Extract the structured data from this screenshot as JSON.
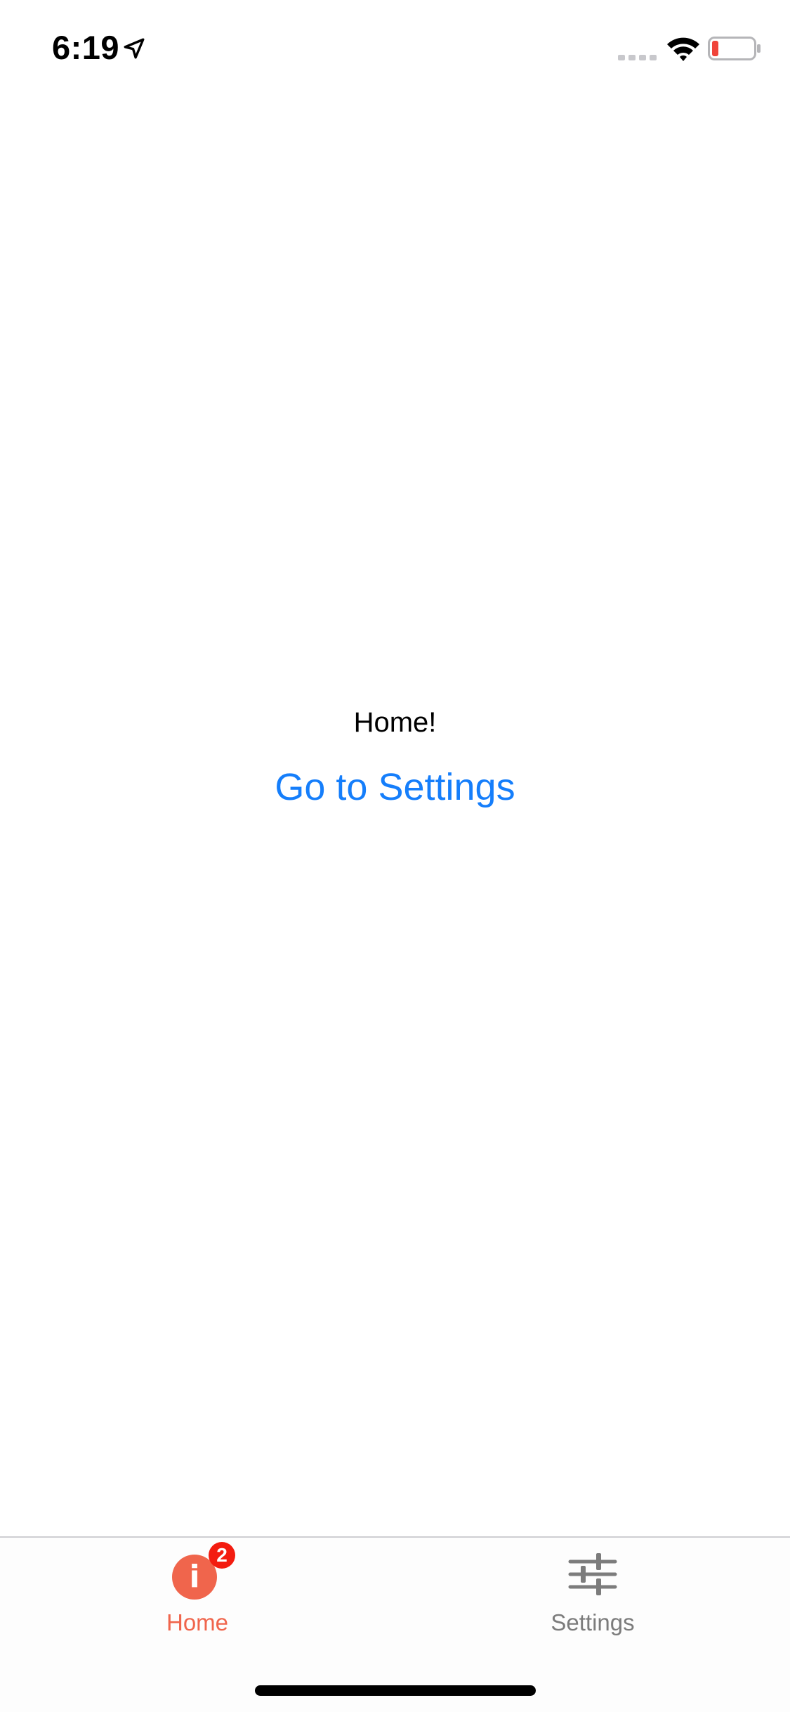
{
  "status_bar": {
    "time": "6:19"
  },
  "main": {
    "title": "Home!",
    "link_label": "Go to Settings"
  },
  "tab_bar": {
    "tabs": [
      {
        "label": "Home",
        "icon": "info-icon",
        "icon_glyph": "i",
        "badge": "2",
        "active": true
      },
      {
        "label": "Settings",
        "icon": "sliders-icon",
        "active": false
      }
    ]
  },
  "colors": {
    "accent": "#f0654c",
    "link": "#157efb",
    "badge": "#f31c10",
    "inactive_tab": "#7c7c7c",
    "battery_low": "#f0443a"
  }
}
